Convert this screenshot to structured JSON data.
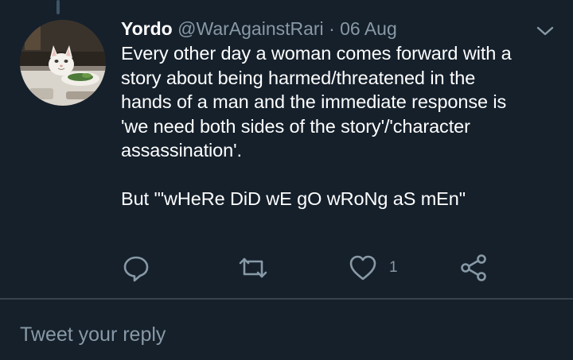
{
  "tweet": {
    "display_name": "Yordo",
    "handle": "@WarAgainstRari",
    "separator": "·",
    "date": "06 Aug",
    "text": "Every other day a woman comes forward with a\nstory about being harmed/threatened in the\nhands of a man and the immediate response is\n'we need both sides of the story'/'character\nassassination'.\n\nBut '\"wHeRe DiD wE gO wRoNg aS mEn\"",
    "like_count": "1"
  },
  "icons": {
    "caret": "chevron-down-icon",
    "reply": "reply-icon",
    "retweet": "retweet-icon",
    "like": "heart-icon",
    "share": "share-icon"
  },
  "reply_box": {
    "placeholder": "Tweet your reply"
  },
  "colors": {
    "background": "#15202b",
    "secondary_text": "#8899a6",
    "divider": "#38444d"
  }
}
